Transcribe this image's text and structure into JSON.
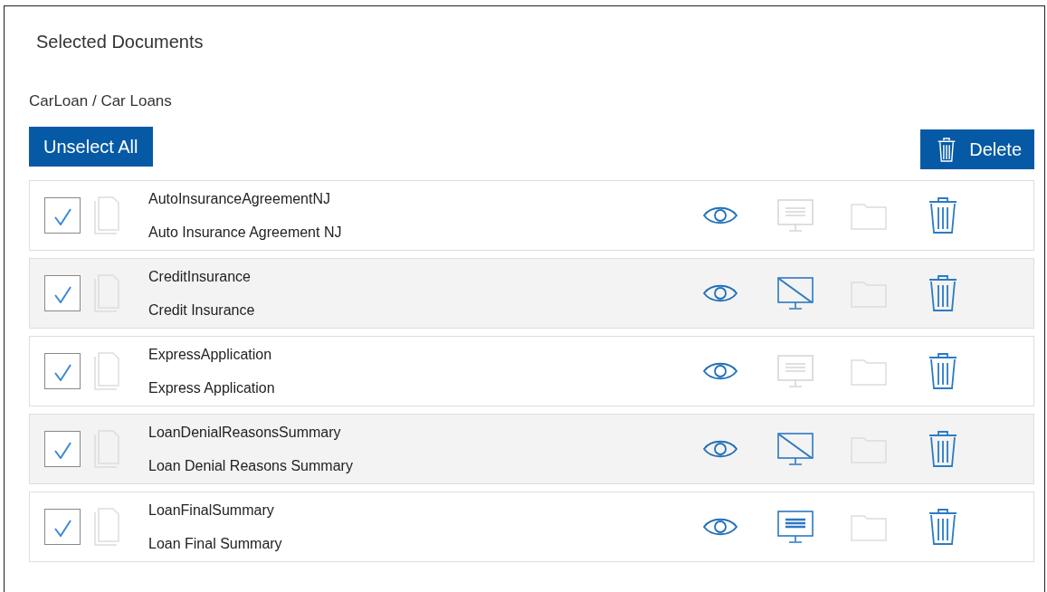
{
  "title": "Selected Documents",
  "breadcrumb": "CarLoan / Car Loans",
  "unselect_button": "Unselect All",
  "delete_button": "Delete",
  "documents": [
    {
      "name": "AutoInsuranceAgreementNJ",
      "description": "Auto Insurance Agreement NJ",
      "checked": true,
      "display_enabled": false,
      "display_blocked": false
    },
    {
      "name": "CreditInsurance",
      "description": "Credit Insurance",
      "checked": true,
      "display_enabled": true,
      "display_blocked": true
    },
    {
      "name": "ExpressApplication",
      "description": "Express Application",
      "checked": true,
      "display_enabled": false,
      "display_blocked": false
    },
    {
      "name": "LoanDenialReasonsSummary",
      "description": "Loan Denial Reasons Summary",
      "checked": true,
      "display_enabled": true,
      "display_blocked": true
    },
    {
      "name": "LoanFinalSummary",
      "description": "Loan Final Summary",
      "checked": true,
      "display_enabled": true,
      "display_blocked": false
    }
  ]
}
